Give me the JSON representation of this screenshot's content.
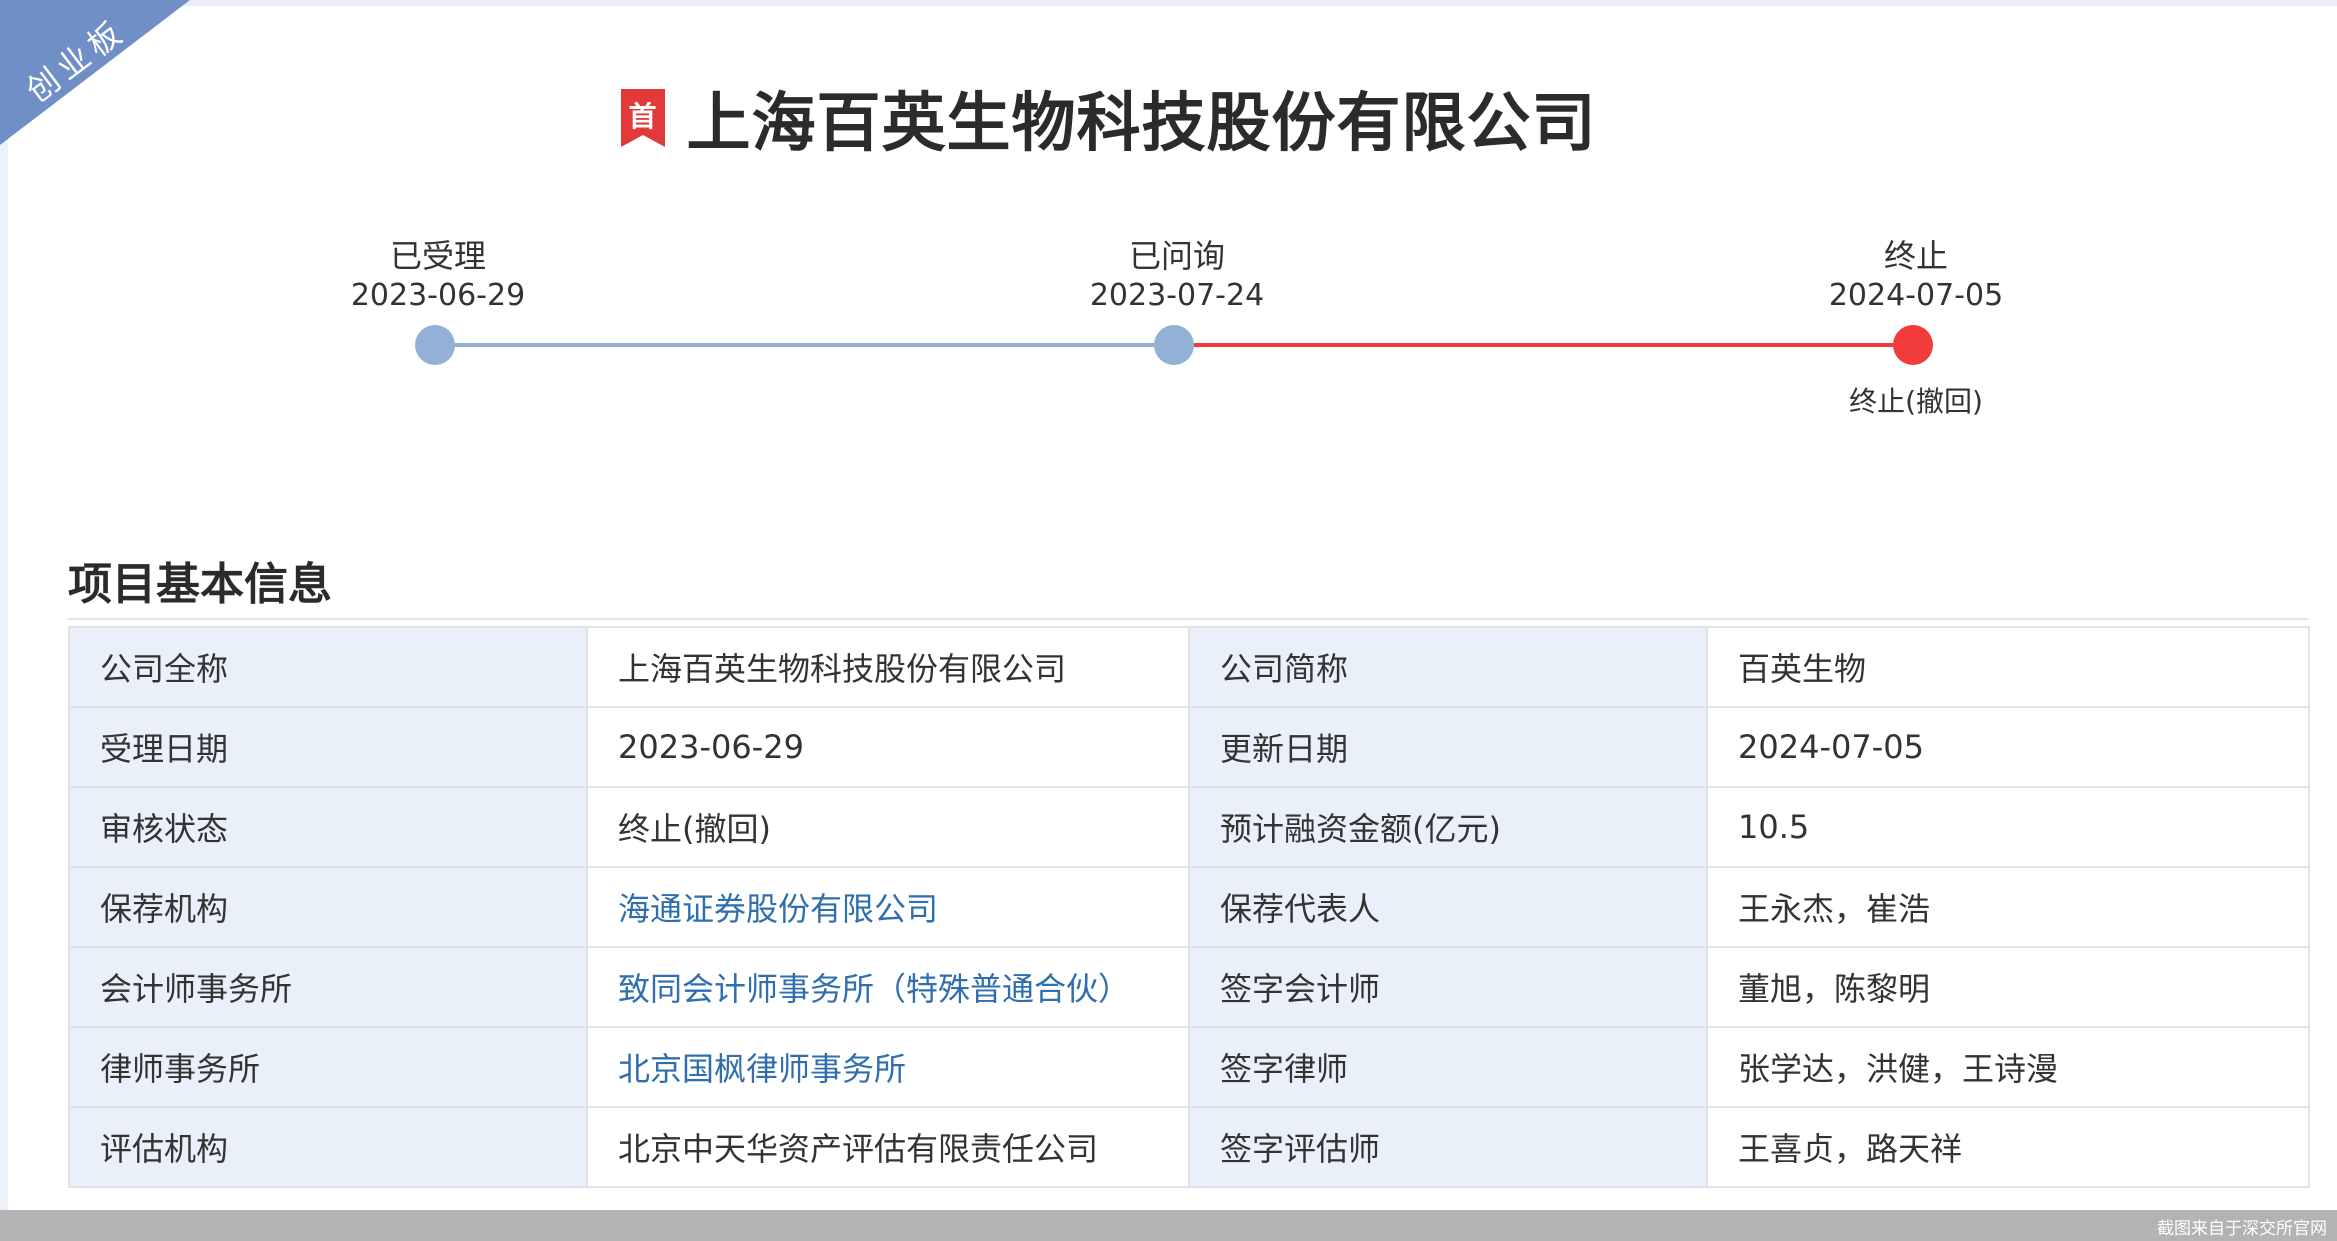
{
  "ribbon": {
    "text": "创业板"
  },
  "header": {
    "badge": "首",
    "title": "上海百英生物科技股份有限公司"
  },
  "timeline": {
    "stages": [
      {
        "label": "已受理",
        "date": "2023-06-29"
      },
      {
        "label": "已问询",
        "date": "2023-07-24"
      },
      {
        "label": "终止",
        "date": "2024-07-05",
        "note": "终止(撤回)"
      }
    ],
    "colors": {
      "done": "#93b0d6",
      "terminated": "#f23b3b"
    }
  },
  "section": {
    "title": "项目基本信息"
  },
  "info": {
    "rows": [
      {
        "l1": "公司全称",
        "v1": "上海百英生物科技股份有限公司",
        "l2": "公司简称",
        "v2": "百英生物"
      },
      {
        "l1": "受理日期",
        "v1": "2023-06-29",
        "l2": "更新日期",
        "v2": "2024-07-05"
      },
      {
        "l1": "审核状态",
        "v1": "终止(撤回)",
        "l2": "预计融资金额(亿元)",
        "v2": "10.5"
      },
      {
        "l1": "保荐机构",
        "v1": "海通证券股份有限公司",
        "l2": "保荐代表人",
        "v2": "王永杰，崔浩"
      },
      {
        "l1": "会计师事务所",
        "v1": "致同会计师事务所（特殊普通合伙）",
        "l2": "签字会计师",
        "v2": "董旭，陈黎明"
      },
      {
        "l1": "律师事务所",
        "v1": "北京国枫律师事务所",
        "l2": "签字律师",
        "v2": "张学达，洪健，王诗漫"
      },
      {
        "l1": "评估机构",
        "v1": "北京中天华资产评估有限责任公司",
        "l2": "签字评估师",
        "v2": "王喜贞，路天祥"
      }
    ]
  },
  "footer": {
    "note": "截图来自于深交所官网"
  }
}
